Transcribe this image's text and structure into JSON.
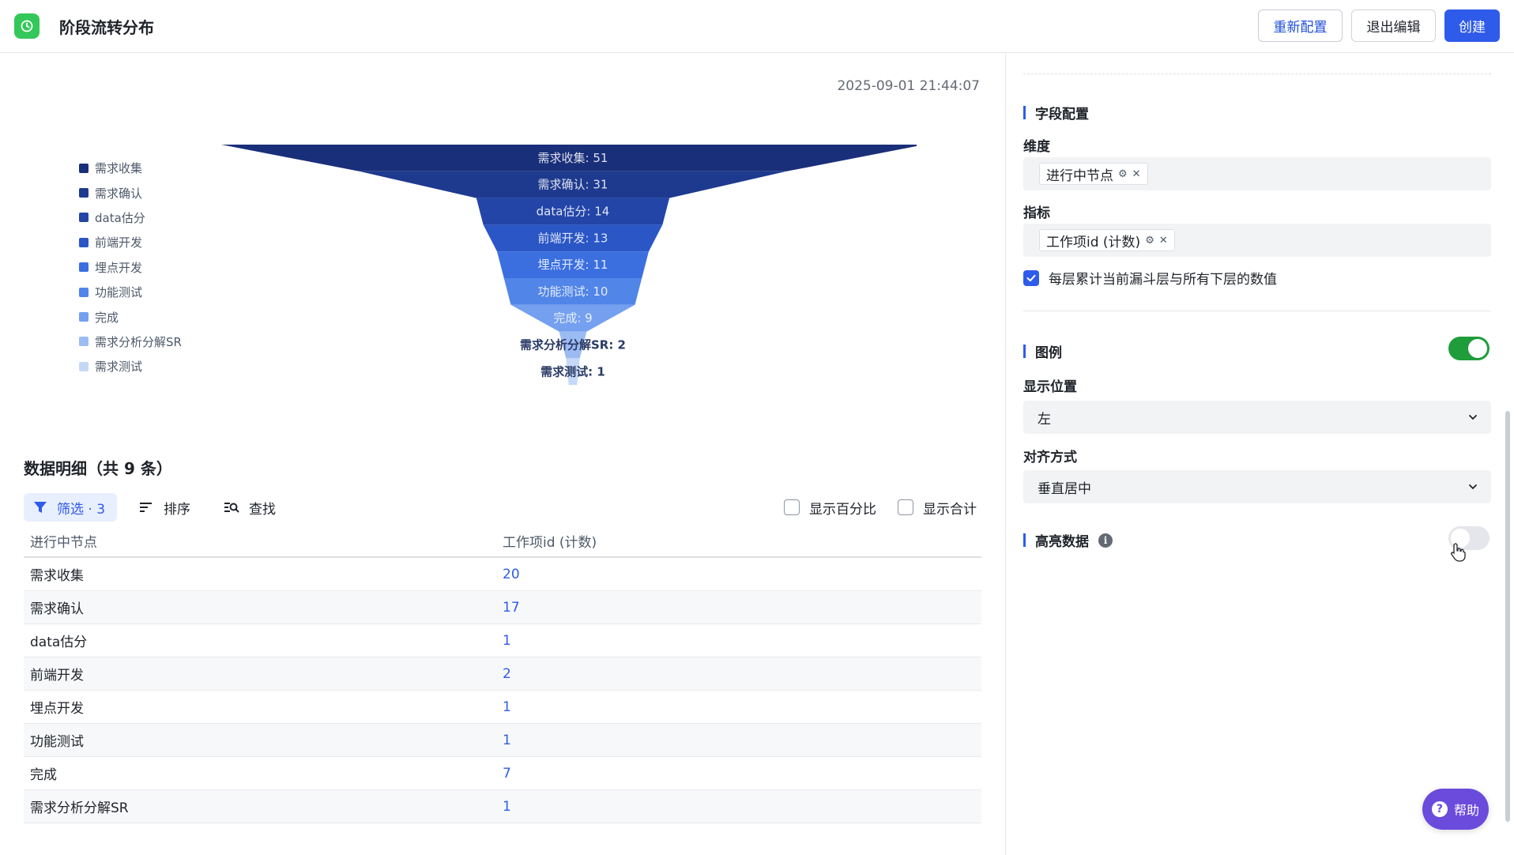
{
  "header": {
    "title": "阶段流转分布",
    "reconfig_label": "重新配置",
    "exit_label": "退出编辑",
    "create_label": "创建"
  },
  "main": {
    "timestamp": "2025-09-01 21:44:07",
    "section_title": "数据明细（共 9 条）",
    "toolbar": {
      "filter_label": "筛选 · 3",
      "sort_label": "排序",
      "find_label": "查找",
      "show_percent_label": "显示百分比",
      "show_total_label": "显示合计"
    },
    "table": {
      "columns": [
        "进行中节点",
        "工作项id (计数)"
      ],
      "rows": [
        [
          "需求收集",
          "20"
        ],
        [
          "需求确认",
          "17"
        ],
        [
          "data估分",
          "1"
        ],
        [
          "前端开发",
          "2"
        ],
        [
          "埋点开发",
          "1"
        ],
        [
          "功能测试",
          "1"
        ],
        [
          "完成",
          "7"
        ],
        [
          "需求分析分解SR",
          "1"
        ]
      ]
    }
  },
  "chart_data": {
    "type": "funnel",
    "categories": [
      "需求收集",
      "需求确认",
      "data估分",
      "前端开发",
      "埋点开发",
      "功能测试",
      "完成",
      "需求分析分解SR",
      "需求测试"
    ],
    "values": [
      51,
      31,
      14,
      13,
      11,
      10,
      9,
      2,
      1
    ],
    "labels": [
      "需求收集: 51",
      "需求确认: 31",
      "data估分: 14",
      "前端开发: 13",
      "埋点开发: 11",
      "功能测试: 10",
      "完成: 9",
      "需求分析分解SR: 2",
      "需求测试: 1"
    ],
    "colors": [
      "#1a2f7a",
      "#1e3a8f",
      "#2345a8",
      "#2a56c6",
      "#3b6fe0",
      "#5185e8",
      "#74a0ef",
      "#9bbcf3",
      "#c6d8f8"
    ],
    "legend_position": "left"
  },
  "panel": {
    "field_config_title": "字段配置",
    "dimension_label": "维度",
    "dimension_tag": "进行中节点",
    "metric_label": "指标",
    "metric_tag": "工作项id (计数)",
    "accumulate_label": "每层累计当前漏斗层与所有下层的数值",
    "legend_title": "图例",
    "position_label": "显示位置",
    "position_value": "左",
    "align_label": "对齐方式",
    "align_value": "垂直居中",
    "highlight_title": "高亮数据"
  },
  "help": {
    "label": "帮助"
  }
}
